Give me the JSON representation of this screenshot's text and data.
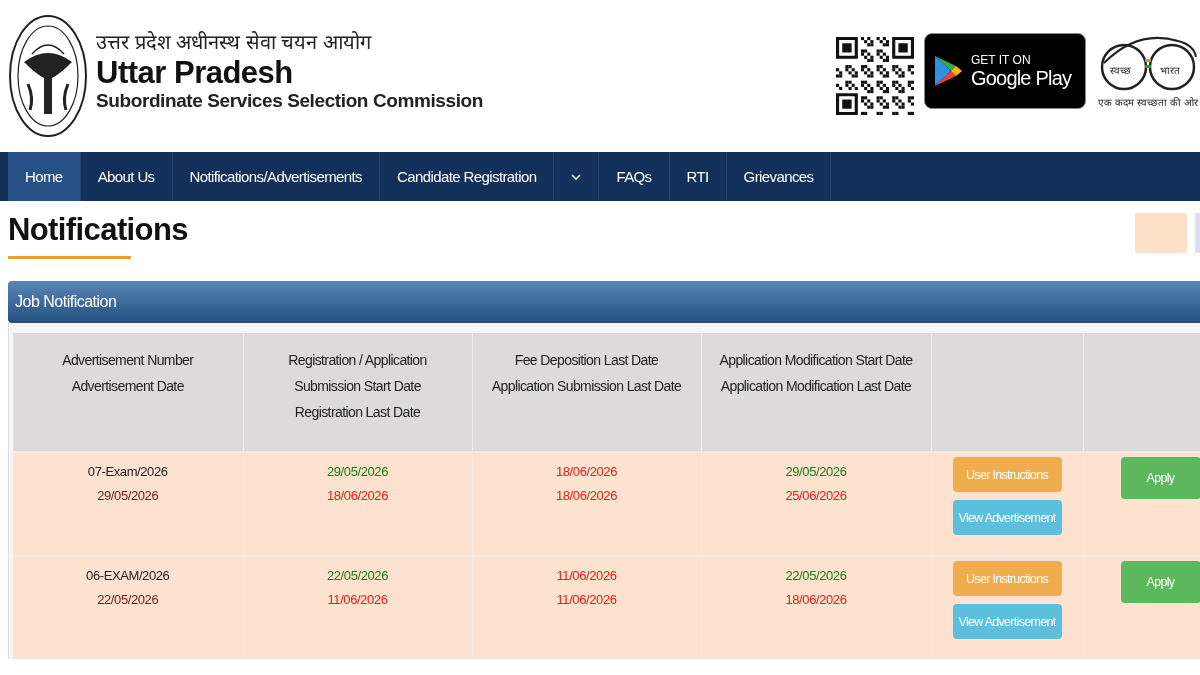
{
  "header": {
    "hindi_title": "उत्तर प्रदेश अधीनस्थ सेवा चयन आयोग",
    "title": "Uttar Pradesh",
    "subtitle": "Subordinate Services Selection Commission",
    "play_badge": {
      "small": "GET IT ON",
      "large": "Google Play"
    },
    "swachh": {
      "left": "स्वच्छ",
      "right": "भारत",
      "tagline": "एक कदम स्वच्छता की ओर"
    }
  },
  "nav": [
    {
      "kind": "link",
      "label": "Home",
      "selected": true
    },
    {
      "kind": "link",
      "label": "About Us",
      "selected": false
    },
    {
      "kind": "link",
      "label": "Notifications/Advertisements",
      "selected": false
    },
    {
      "kind": "link",
      "label": "Candidate Registration",
      "selected": false
    },
    {
      "kind": "dropdown",
      "selected": false
    },
    {
      "kind": "link",
      "label": "FAQs",
      "selected": false
    },
    {
      "kind": "link",
      "label": "RTI",
      "selected": false
    },
    {
      "kind": "link",
      "label": "Grievances",
      "selected": false
    }
  ],
  "page_title": "Notifications",
  "panel": {
    "title": "Job Notification",
    "columns": [
      [
        "Advertisement Number",
        "Advertisement Date"
      ],
      [
        "Registration / Application",
        "Submission  Start Date",
        "Registration Last Date"
      ],
      [
        "Fee Deposition Last Date",
        "Application Submission Last Date"
      ],
      [
        "Application Modification Start Date",
        "Application Modification Last Date"
      ]
    ],
    "rows": [
      {
        "adv_number": "07-Exam/2026",
        "adv_date": "29/05/2026",
        "registration_start": "29/05/2026",
        "registration_last": "18/06/2026",
        "fee_last": "18/06/2026",
        "submission_last": "18/06/2026",
        "modification_start": "29/05/2026",
        "modification_last": "25/06/2026",
        "instructions": "User Instructions",
        "view": "View Advertisement",
        "apply": "Apply"
      },
      {
        "adv_number": "06-EXAM/2026",
        "adv_date": "22/05/2026",
        "registration_start": "22/05/2026",
        "registration_last": "11/06/2026",
        "fee_last": "11/06/2026",
        "submission_last": "11/06/2026",
        "modification_start": "22/05/2026",
        "modification_last": "18/06/2026",
        "instructions": "User Instructions",
        "view": "View Advertisement",
        "apply": "Apply"
      }
    ]
  }
}
